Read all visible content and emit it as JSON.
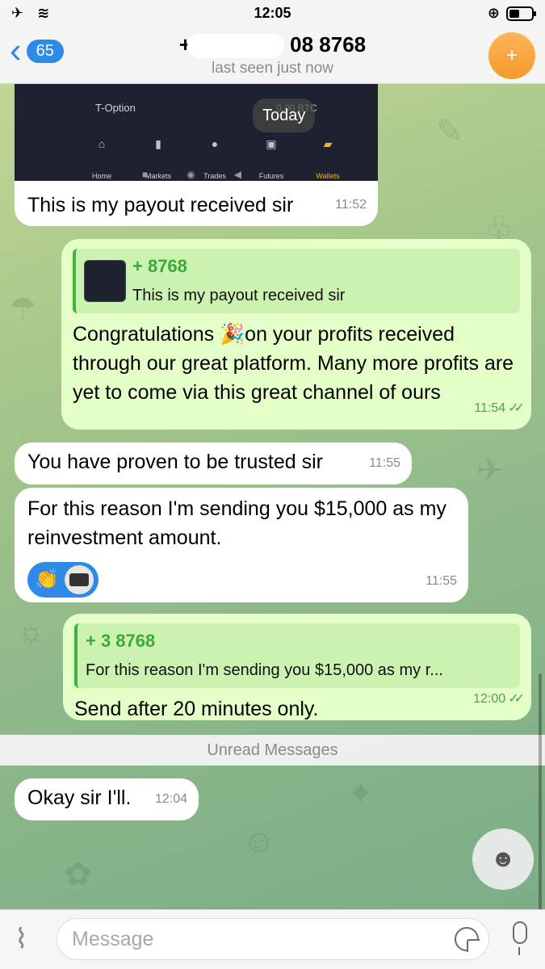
{
  "status_bar": {
    "time": "12:05",
    "left_icons": "airplane-icon wifi-icon",
    "right_icons": "lock-rotation-icon battery-icon"
  },
  "header": {
    "back_count": "65",
    "title": "+ 08 8768",
    "title_visible": "08 8768",
    "subtitle": "last seen just now",
    "avatar_symbol": "+",
    "avatar_color": "#f39a2c"
  },
  "trading_screenshot": {
    "brand": "T-Option",
    "balance": "0.00 BTC",
    "tabs": [
      "Home",
      "Markets",
      "Trades",
      "Futures",
      "Wallets"
    ],
    "active_tab": "Wallets"
  },
  "date_pill": "Today",
  "messages": [
    {
      "dir": "in",
      "text": "This is my payout received sir",
      "time": "11:52"
    },
    {
      "dir": "out",
      "reply_name": "+ 8768",
      "reply_text": "This is my payout received sir",
      "text": "Congratulations 🎉on your  profits received through our great platform. Many more profits are yet to come via this great channel of ours",
      "time": "11:54"
    },
    {
      "dir": "in",
      "text": "You have proven to be trusted sir",
      "time": "11:55"
    },
    {
      "dir": "in",
      "text": "For this reason I'm sending you $15,000 as my reinvestment amount.",
      "reaction": "👏",
      "time": "11:55"
    },
    {
      "dir": "out",
      "reply_name": "+ 3 8768",
      "reply_text": "For this reason I'm sending you $15,000 as my r...",
      "text": "Send after 20 minutes only.",
      "time": "12:00"
    },
    {
      "dir": "in",
      "text": "Okay sir I'll.",
      "time": "12:04"
    }
  ],
  "unread_label": "Unread Messages",
  "input": {
    "placeholder": "Message"
  },
  "colors": {
    "accent": "#2d8ae8",
    "outgoing": "#e3fec6",
    "incoming": "#ffffff",
    "tick": "#4da54b"
  }
}
